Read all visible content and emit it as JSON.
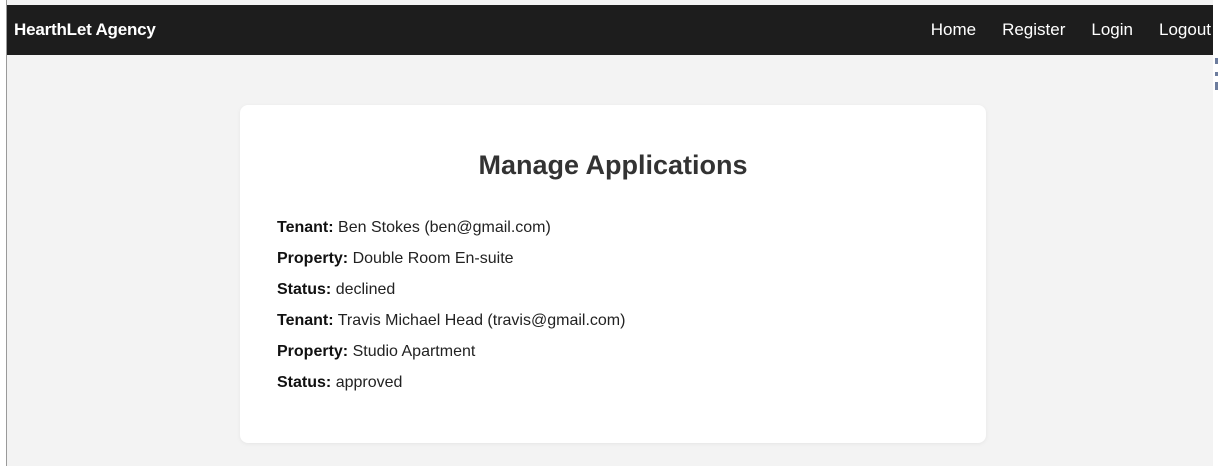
{
  "brand": "HearthLet Agency",
  "nav": {
    "home": "Home",
    "register": "Register",
    "login": "Login",
    "logout": "Logout"
  },
  "page_title": "Manage Applications",
  "labels": {
    "tenant": "Tenant:",
    "property": "Property:",
    "status": "Status:"
  },
  "applications": [
    {
      "tenant": "Ben Stokes (ben@gmail.com)",
      "property": "Double Room En-suite",
      "status": "declined"
    },
    {
      "tenant": "Travis Michael Head (travis@gmail.com)",
      "property": "Studio Apartment",
      "status": "approved"
    }
  ],
  "colors": {
    "navbar_bg": "#1d1d1d",
    "page_bg": "#f3f3f3",
    "card_bg": "#ffffff"
  }
}
